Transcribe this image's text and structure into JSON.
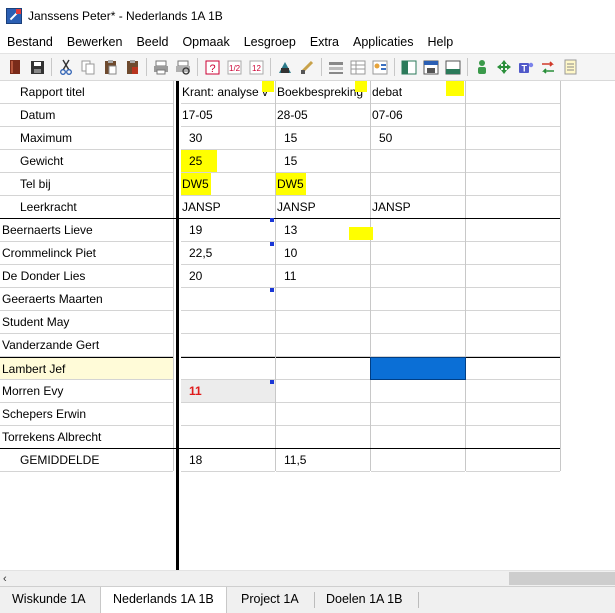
{
  "window": {
    "title": "Janssens Peter* - Nederlands 1A 1B"
  },
  "menu": [
    "Bestand",
    "Bewerken",
    "Beeld",
    "Opmaak",
    "Lesgroep",
    "Extra",
    "Applicaties",
    "Help"
  ],
  "toolbar": {
    "icons": [
      "book-icon",
      "save-icon",
      "cut-icon",
      "copy-icon",
      "paste-icon",
      "paste-special-icon",
      "print-icon",
      "print-preview-icon",
      "help-icon",
      "chart-icon",
      "table-icon",
      "settings-icon",
      "brush-icon",
      "list-icon",
      "grid-icon",
      "user-card-icon",
      "window-icon",
      "window-save-icon",
      "window-bottom-icon",
      "person-icon",
      "move-icon",
      "teams-icon",
      "swap-icon",
      "notes-icon"
    ]
  },
  "rows_meta": [
    {
      "label": "Rapport titel",
      "values": [
        "Krant: analyse v",
        "Boekbespreking",
        "debat"
      ]
    },
    {
      "label": "Datum",
      "values": [
        "17-05",
        "28-05",
        "07-06"
      ]
    },
    {
      "label": "Maximum",
      "values": [
        "30",
        "15",
        "50"
      ]
    },
    {
      "label": "Gewicht",
      "values": [
        "25",
        "15",
        ""
      ]
    },
    {
      "label": "Tel bij",
      "values": [
        "DW5",
        "DW5",
        ""
      ]
    },
    {
      "label": "Leerkracht",
      "values": [
        "JANSP",
        "JANSP",
        "JANSP"
      ]
    }
  ],
  "students": [
    {
      "name": "Beernaerts Lieve",
      "scores": [
        "19",
        "13",
        ""
      ]
    },
    {
      "name": "Crommelinck Piet",
      "scores": [
        "22,5",
        "10",
        ""
      ]
    },
    {
      "name": "De Donder Lies",
      "scores": [
        "20",
        "11",
        ""
      ]
    },
    {
      "name": "Geeraerts Maarten",
      "scores": [
        "",
        "",
        ""
      ]
    },
    {
      "name": "Student May",
      "scores": [
        "",
        "",
        ""
      ]
    },
    {
      "name": "Vanderzande Gert",
      "scores": [
        "",
        "",
        ""
      ]
    },
    {
      "name": "Lambert Jef",
      "scores": [
        "",
        "",
        ""
      ]
    },
    {
      "name": "Morren Evy",
      "scores": [
        "11",
        "",
        ""
      ]
    },
    {
      "name": "Schepers Erwin",
      "scores": [
        "",
        "",
        ""
      ]
    },
    {
      "name": "Torrekens Albrecht",
      "scores": [
        "",
        "",
        ""
      ]
    }
  ],
  "average": {
    "label": "GEMIDDELDE",
    "values": [
      "18",
      "11,5",
      ""
    ]
  },
  "tabs": [
    "Wiskunde 1A",
    "Nederlands 1A 1B",
    "Project 1A",
    "Doelen 1A 1B"
  ],
  "active_tab": "Nederlands 1A 1B",
  "colors": {
    "highlight": "#ffff00",
    "selection": "#0b6fd6",
    "selected_row": "#fffbd8",
    "failing_score": "#e01b1b"
  }
}
